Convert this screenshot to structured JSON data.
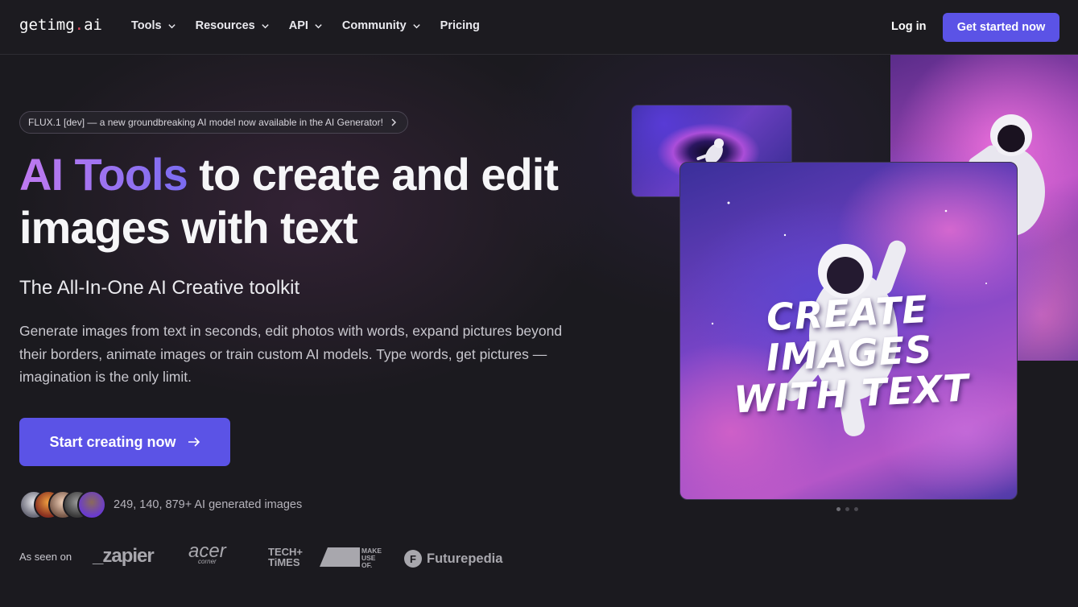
{
  "nav": {
    "logo": {
      "prefix": "getimg",
      "dot": ".",
      "suffix": "ai"
    },
    "links": [
      {
        "label": "Tools",
        "has_dropdown": true
      },
      {
        "label": "Resources",
        "has_dropdown": true
      },
      {
        "label": "API",
        "has_dropdown": true
      },
      {
        "label": "Community",
        "has_dropdown": true
      },
      {
        "label": "Pricing",
        "has_dropdown": false
      }
    ],
    "login_label": "Log in",
    "cta_label": "Get started now"
  },
  "hero": {
    "announcement": "FLUX.1 [dev] — a new groundbreaking AI model now available in the AI Generator!",
    "title_highlight": "AI Tools",
    "title_rest": " to create and edit images with text",
    "subtitle": "The All-In-One AI Creative toolkit",
    "description": "Generate images from text in seconds, edit photos with words, expand pictures beyond their borders, animate images or train custom AI models. Type words, get pictures — imagination is the only limit.",
    "cta_label": "Start creating now",
    "stats_text": "249, 140, 879+ AI generated images"
  },
  "press": {
    "label": "As seen on",
    "logos": {
      "zapier": "_zapier",
      "acer": "acer",
      "acer_sub": "corner",
      "tech_line1": "TECH+",
      "tech_line2": "TiMES",
      "muo_line1": "MAKE",
      "muo_line2": "USE",
      "muo_line3": "OF.",
      "futurepedia": "Futurepedia",
      "futurepedia_badge": "F"
    }
  },
  "showcase": {
    "main_caption_line1": "CREATE IMAGES",
    "main_caption_line2": "WITH TEXT",
    "carousel_dots": 3,
    "active_dot": 0
  },
  "colors": {
    "accent": "#5b53e6",
    "background": "#1b1a1f",
    "gradient_start": "#c07af0",
    "gradient_end": "#7a6cf0"
  }
}
